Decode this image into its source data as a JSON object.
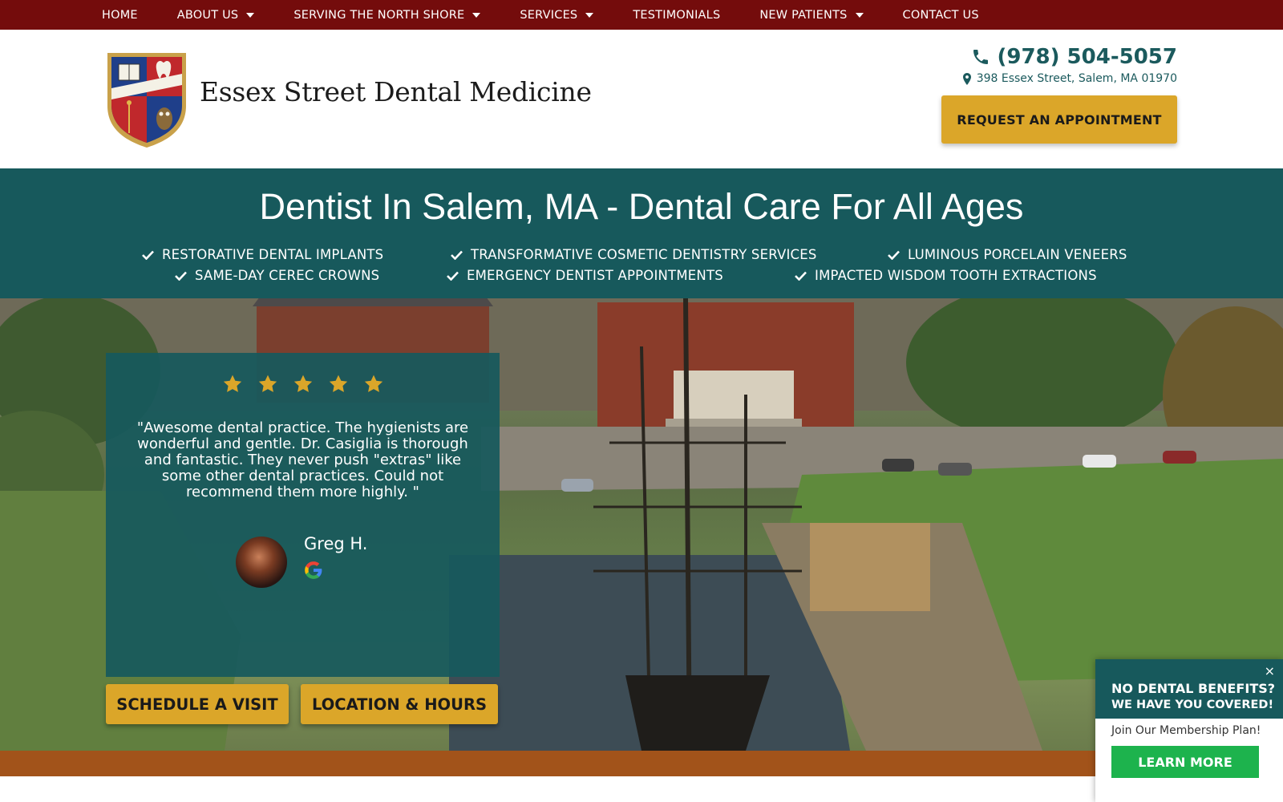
{
  "nav": {
    "items": [
      {
        "label": "HOME",
        "dropdown": false
      },
      {
        "label": "ABOUT US",
        "dropdown": true
      },
      {
        "label": "SERVING THE NORTH SHORE",
        "dropdown": true
      },
      {
        "label": "SERVICES",
        "dropdown": true
      },
      {
        "label": "TESTIMONIALS",
        "dropdown": false
      },
      {
        "label": "NEW PATIENTS",
        "dropdown": true
      },
      {
        "label": "CONTACT US",
        "dropdown": false
      }
    ]
  },
  "header": {
    "practice_name": "Essex Street Dental Medicine",
    "phone": "(978) 504-5057",
    "address": "398 Essex Street, Salem, MA 01970",
    "appointment_button": "REQUEST AN APPOINTMENT"
  },
  "banner": {
    "title": "Dentist In Salem, MA - Dental Care For All Ages",
    "features": [
      "RESTORATIVE DENTAL IMPLANTS",
      "TRANSFORMATIVE COSMETIC DENTISTRY SERVICES",
      "LUMINOUS PORCELAIN VENEERS",
      "SAME-DAY CEREC CROWNS",
      "EMERGENCY DENTIST APPOINTMENTS",
      "IMPACTED WISDOM TOOTH EXTRACTIONS"
    ]
  },
  "review": {
    "rating": 5,
    "quote": "\"Awesome dental practice. The hygienists are wonderful and gentle. Dr. Casiglia is thorough and fantastic. They never push \"extras\" like some other dental practices. Could not recommend them more highly. \"",
    "reviewer": "Greg H.",
    "source_icon": "google-icon"
  },
  "hero_buttons": {
    "schedule": "SCHEDULE A VISIT",
    "location": "LOCATION & HOURS"
  },
  "popup": {
    "close": "×",
    "title_line1": "NO DENTAL BENEFITS?",
    "title_line2": "WE HAVE YOU COVERED!",
    "join_text": "Join Our Membership Plan!",
    "button": "LEARN MORE"
  },
  "colors": {
    "nav_bg": "#740c0c",
    "teal": "#17595c",
    "gold": "#dba629",
    "strip": "#a2531a",
    "popup_button": "#1db34d",
    "star": "#dba629"
  }
}
